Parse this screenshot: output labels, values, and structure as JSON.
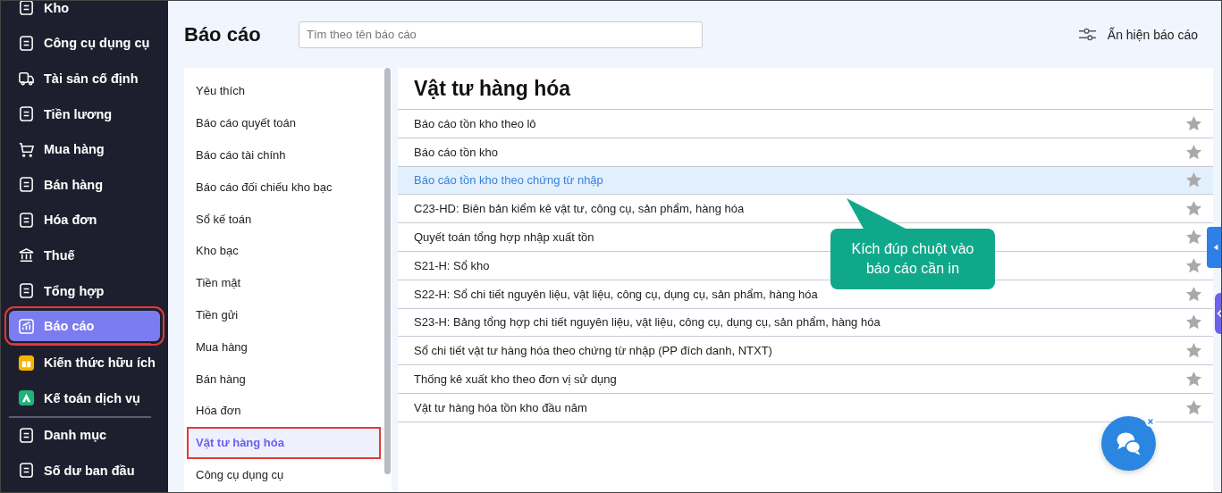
{
  "sidebar": {
    "items": [
      {
        "label": "Kho",
        "selected": false,
        "highlighted": false
      },
      {
        "label": "Công cụ dụng cụ",
        "selected": false,
        "highlighted": false
      },
      {
        "label": "Tài sản cố định",
        "selected": false,
        "highlighted": false
      },
      {
        "label": "Tiền lương",
        "selected": false,
        "highlighted": false
      },
      {
        "label": "Mua hàng",
        "selected": false,
        "highlighted": false
      },
      {
        "label": "Bán hàng",
        "selected": false,
        "highlighted": false
      },
      {
        "label": "Hóa đơn",
        "selected": false,
        "highlighted": false
      },
      {
        "label": "Thuế",
        "selected": false,
        "highlighted": false
      },
      {
        "label": "Tổng hợp",
        "selected": false,
        "highlighted": false
      },
      {
        "label": "Báo cáo",
        "selected": true,
        "highlighted": true
      },
      {
        "label": "Kiến thức hữu ích",
        "selected": false,
        "highlighted": false
      },
      {
        "label": "Kế toán dịch vụ",
        "selected": false,
        "highlighted": false
      },
      {
        "label": "Danh mục",
        "selected": false,
        "highlighted": false
      },
      {
        "label": "Số dư ban đầu",
        "selected": false,
        "highlighted": false
      }
    ]
  },
  "header": {
    "title": "Báo cáo",
    "search": {
      "placeholder": "Tìm theo tên báo cáo"
    },
    "toggle_button": "Ẩn hiện báo cáo"
  },
  "categories": [
    {
      "label": "Yêu thích",
      "selected": false,
      "highlighted": false
    },
    {
      "label": "Báo cáo quyết toán",
      "selected": false,
      "highlighted": false
    },
    {
      "label": "Báo cáo tài chính",
      "selected": false,
      "highlighted": false
    },
    {
      "label": "Báo cáo đối chiếu kho bạc",
      "selected": false,
      "highlighted": false
    },
    {
      "label": "Sổ kế toán",
      "selected": false,
      "highlighted": false
    },
    {
      "label": "Kho bạc",
      "selected": false,
      "highlighted": false
    },
    {
      "label": "Tiền mặt",
      "selected": false,
      "highlighted": false
    },
    {
      "label": "Tiền gửi",
      "selected": false,
      "highlighted": false
    },
    {
      "label": "Mua hàng",
      "selected": false,
      "highlighted": false
    },
    {
      "label": "Bán hàng",
      "selected": false,
      "highlighted": false
    },
    {
      "label": "Hóa đơn",
      "selected": false,
      "highlighted": false
    },
    {
      "label": "Vật tư hàng hóa",
      "selected": true,
      "highlighted": true
    },
    {
      "label": "Công cụ dụng cụ",
      "selected": false,
      "highlighted": false
    }
  ],
  "reports": {
    "title": "Vật tư hàng hóa",
    "rows": [
      {
        "label": "Báo cáo tồn kho theo lô",
        "selected": false,
        "favorite": false
      },
      {
        "label": "Báo cáo tồn kho",
        "selected": false,
        "favorite": false
      },
      {
        "label": "Báo cáo tồn kho theo chứng từ nhập",
        "selected": true,
        "favorite": false
      },
      {
        "label": "C23-HD: Biên bản kiểm kê vật tư, công cụ, sản phẩm, hàng hóa",
        "selected": false,
        "favorite": false
      },
      {
        "label": "Quyết toán tổng hợp nhập xuất tồn",
        "selected": false,
        "favorite": false
      },
      {
        "label": "S21-H: Sổ kho",
        "selected": false,
        "favorite": false
      },
      {
        "label": "S22-H: Sổ chi tiết nguyên liệu, vật liệu, công cụ, dụng cụ, sản phẩm, hàng hóa",
        "selected": false,
        "favorite": false
      },
      {
        "label": "S23-H: Bảng tổng hợp chi tiết nguyên liệu, vật liệu, công cụ, dụng cụ, sản phẩm, hàng hóa",
        "selected": false,
        "favorite": false
      },
      {
        "label": "Sổ chi tiết vật tư hàng hóa theo chứng từ nhập (PP đích danh, NTXT)",
        "selected": false,
        "favorite": false
      },
      {
        "label": "Thống kê xuất kho theo đơn vị sử dụng",
        "selected": false,
        "favorite": false
      },
      {
        "label": "Vật tư hàng hóa tồn kho đầu năm",
        "selected": false,
        "favorite": false
      }
    ]
  },
  "callout": {
    "text": "Kích đúp chuột vào báo cáo cần in"
  }
}
